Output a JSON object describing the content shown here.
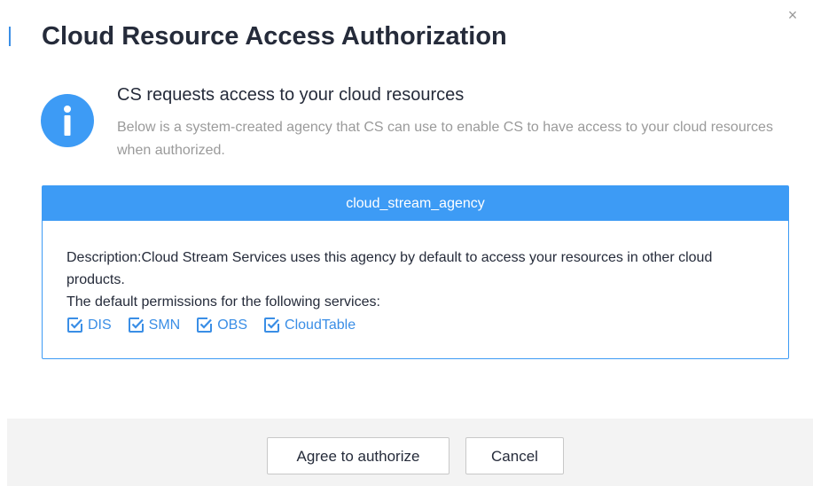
{
  "dialog": {
    "title": "Cloud Resource Access Authorization",
    "close_glyph": "×"
  },
  "request": {
    "icon": "info-icon",
    "heading": "CS requests access to your cloud resources",
    "description": "Below is a system-created agency that CS can use to enable CS to have access to your cloud resources when authorized."
  },
  "agency": {
    "name": "cloud_stream_agency",
    "description": "Description:Cloud Stream Services uses this agency by default to access your resources in other cloud products.",
    "permissions_label": "The default permissions for the following services:",
    "permissions": [
      {
        "label": "DIS",
        "checked": true
      },
      {
        "label": "SMN",
        "checked": true
      },
      {
        "label": "OBS",
        "checked": true
      },
      {
        "label": "CloudTable",
        "checked": true
      }
    ]
  },
  "footer": {
    "agree_label": "Agree to authorize",
    "cancel_label": "Cancel"
  },
  "colors": {
    "accent": "#3d9bf5",
    "link": "#3a8ee6",
    "title": "#252b3a",
    "muted": "#9a9a9a",
    "footer_bg": "#f3f3f3"
  }
}
